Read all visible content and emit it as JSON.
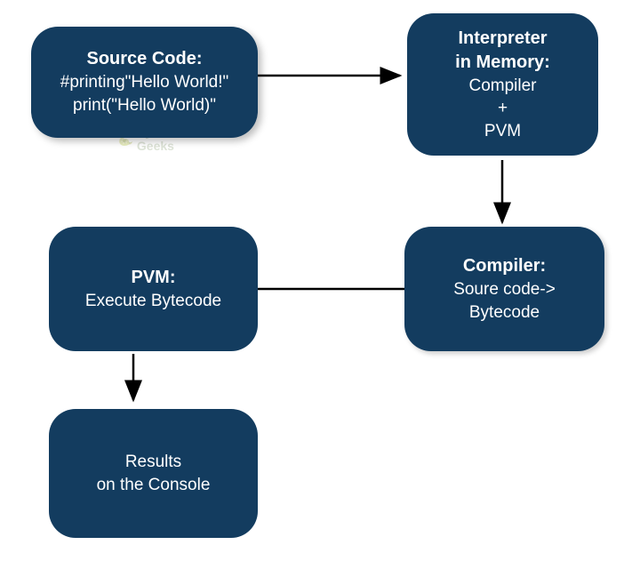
{
  "nodes": {
    "source": {
      "title": "Source Code:",
      "line1": "#printing\"Hello World!\"",
      "line2": "print(\"Hello World)\""
    },
    "interpreter": {
      "title1": "Interpreter",
      "title2": "in Memory:",
      "line1": "Compiler",
      "line2": "+",
      "line3": "PVM"
    },
    "compiler": {
      "title": "Compiler:",
      "line1": "Soure code->",
      "line2": "Bytecode"
    },
    "pvm": {
      "title": "PVM:",
      "line1": "Execute Bytecode"
    },
    "results": {
      "line1": "Results",
      "line2": "on the Console"
    }
  },
  "watermark": {
    "text1": "Python",
    "text2": "Geeks"
  },
  "edges": [
    {
      "from": "source",
      "to": "interpreter",
      "type": "arrow"
    },
    {
      "from": "interpreter",
      "to": "compiler",
      "type": "arrow"
    },
    {
      "from": "compiler",
      "to": "pvm",
      "type": "line"
    },
    {
      "from": "pvm",
      "to": "results",
      "type": "arrow"
    }
  ],
  "colors": {
    "node_bg": "#133c5f",
    "node_text": "#ffffff",
    "arrow": "#000000"
  }
}
